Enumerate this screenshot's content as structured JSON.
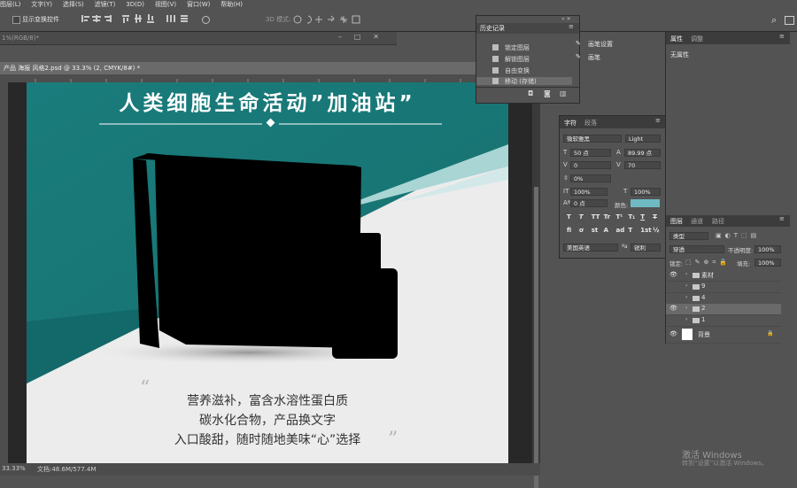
{
  "menubar": [
    "图层(L)",
    "文字(Y)",
    "选择(S)",
    "滤镜(T)",
    "3D(D)",
    "视图(V)",
    "窗口(W)",
    "帮助(H)"
  ],
  "options": {
    "show_transform_label": "显示变换控件",
    "mode_label": "3D 模式:"
  },
  "doc_back_title": "1%(RGB/8)*",
  "doc_tab_title": "产品 海报 风格2.psd @ 33.3% (2, CMYK/8#) *",
  "poster": {
    "headline": "人类细胞生命活动”加油站”",
    "copy_lines": [
      "营养滋补，富含水溶性蛋白质",
      "碳水化合物，产品换文字",
      "入口酸甜，随时随地美味“心”选择"
    ],
    "colors": {
      "teal": "#1b8584",
      "light_teal": "#a7d4d4",
      "bg": "#ececec"
    }
  },
  "status": {
    "zoom": "33.33%",
    "doc_size": "文档:48.6M/577.4M"
  },
  "history": {
    "title": "历史记录",
    "items": [
      "锁定图层",
      "解锁图层",
      "自由变换",
      "移动 (存储)"
    ],
    "selected_index": 3
  },
  "brush_panel": {
    "items": [
      "画笔设置",
      "画笔"
    ]
  },
  "properties": {
    "tabs": [
      "属性",
      "调整"
    ],
    "body": "无属性"
  },
  "character": {
    "tabs": [
      "字符",
      "段落"
    ],
    "font_family": "微软雅黑",
    "font_style": "Light",
    "size": "50 点",
    "leading": "89.99 点",
    "kerning": "0",
    "tracking": "70",
    "scale_pct": "0%",
    "vscale": "100%",
    "hscale": "100%",
    "baseline": "0 点",
    "color_label": "颜色:",
    "language": "美国英语",
    "antialias": "锐利",
    "format_buttons": [
      "T",
      "T",
      "TT",
      "Tr",
      "T¹",
      "T₁",
      "T",
      "T"
    ],
    "ot_buttons": [
      "fi",
      "ơ",
      "st",
      "A",
      "ad",
      "T",
      "1st",
      "½"
    ]
  },
  "layers": {
    "tabs": [
      "图层",
      "通道",
      "路径"
    ],
    "filter": "类型",
    "blend": "穿透",
    "opacity_label": "不透明度:",
    "opacity": "100%",
    "lock_label": "锁定:",
    "fill_label": "填充:",
    "fill": "100%",
    "rows": [
      {
        "name": "素材",
        "visible": true,
        "group": true
      },
      {
        "name": "9",
        "visible": false,
        "group": true
      },
      {
        "name": "4",
        "visible": false,
        "group": true
      },
      {
        "name": "2",
        "visible": true,
        "group": true
      },
      {
        "name": "1",
        "visible": false,
        "group": true
      },
      {
        "name": "背景",
        "visible": true,
        "group": false
      }
    ],
    "selected_index": 3
  },
  "windows_notice": {
    "line1": "激活 Windows",
    "line2": "转到“设置”以激活 Windows。"
  }
}
